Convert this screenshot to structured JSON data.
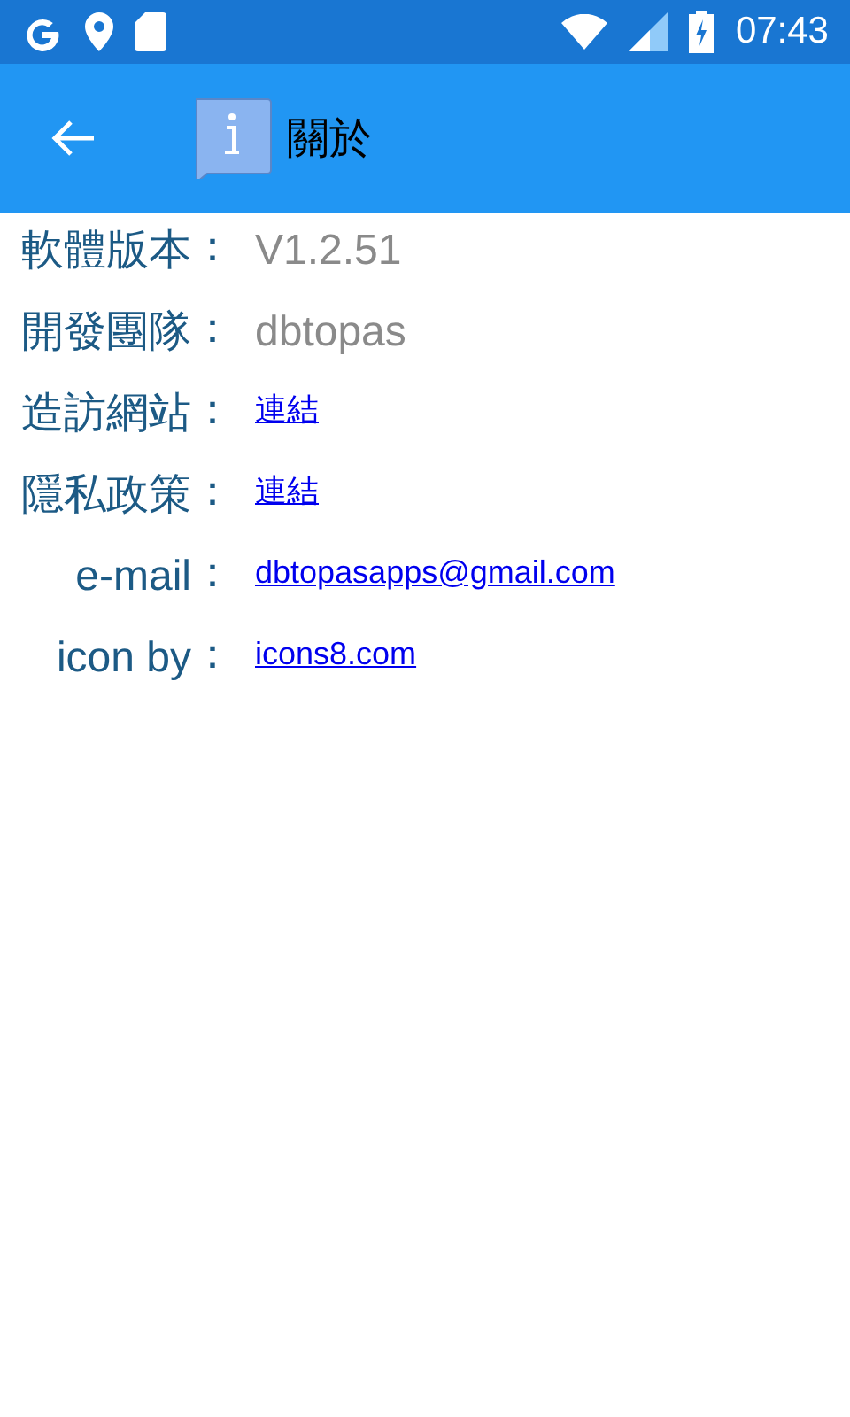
{
  "status_bar": {
    "time": "07:43"
  },
  "app_bar": {
    "title": "關於"
  },
  "rows": [
    {
      "label": "軟體版本",
      "colon": "：",
      "kind": "text",
      "value": "V1.2.51"
    },
    {
      "label": "開發團隊",
      "colon": "：",
      "kind": "text",
      "value": "dbtopas"
    },
    {
      "label": "造訪網站",
      "colon": "：",
      "kind": "link",
      "value": "連結"
    },
    {
      "label": "隱私政策",
      "colon": "：",
      "kind": "link",
      "value": "連結"
    },
    {
      "label": "e-mail",
      "colon": "：",
      "kind": "link",
      "value": "dbtopasapps@gmail.com"
    },
    {
      "label": "icon by",
      "colon": "：",
      "kind": "link",
      "value": "icons8.com"
    }
  ]
}
